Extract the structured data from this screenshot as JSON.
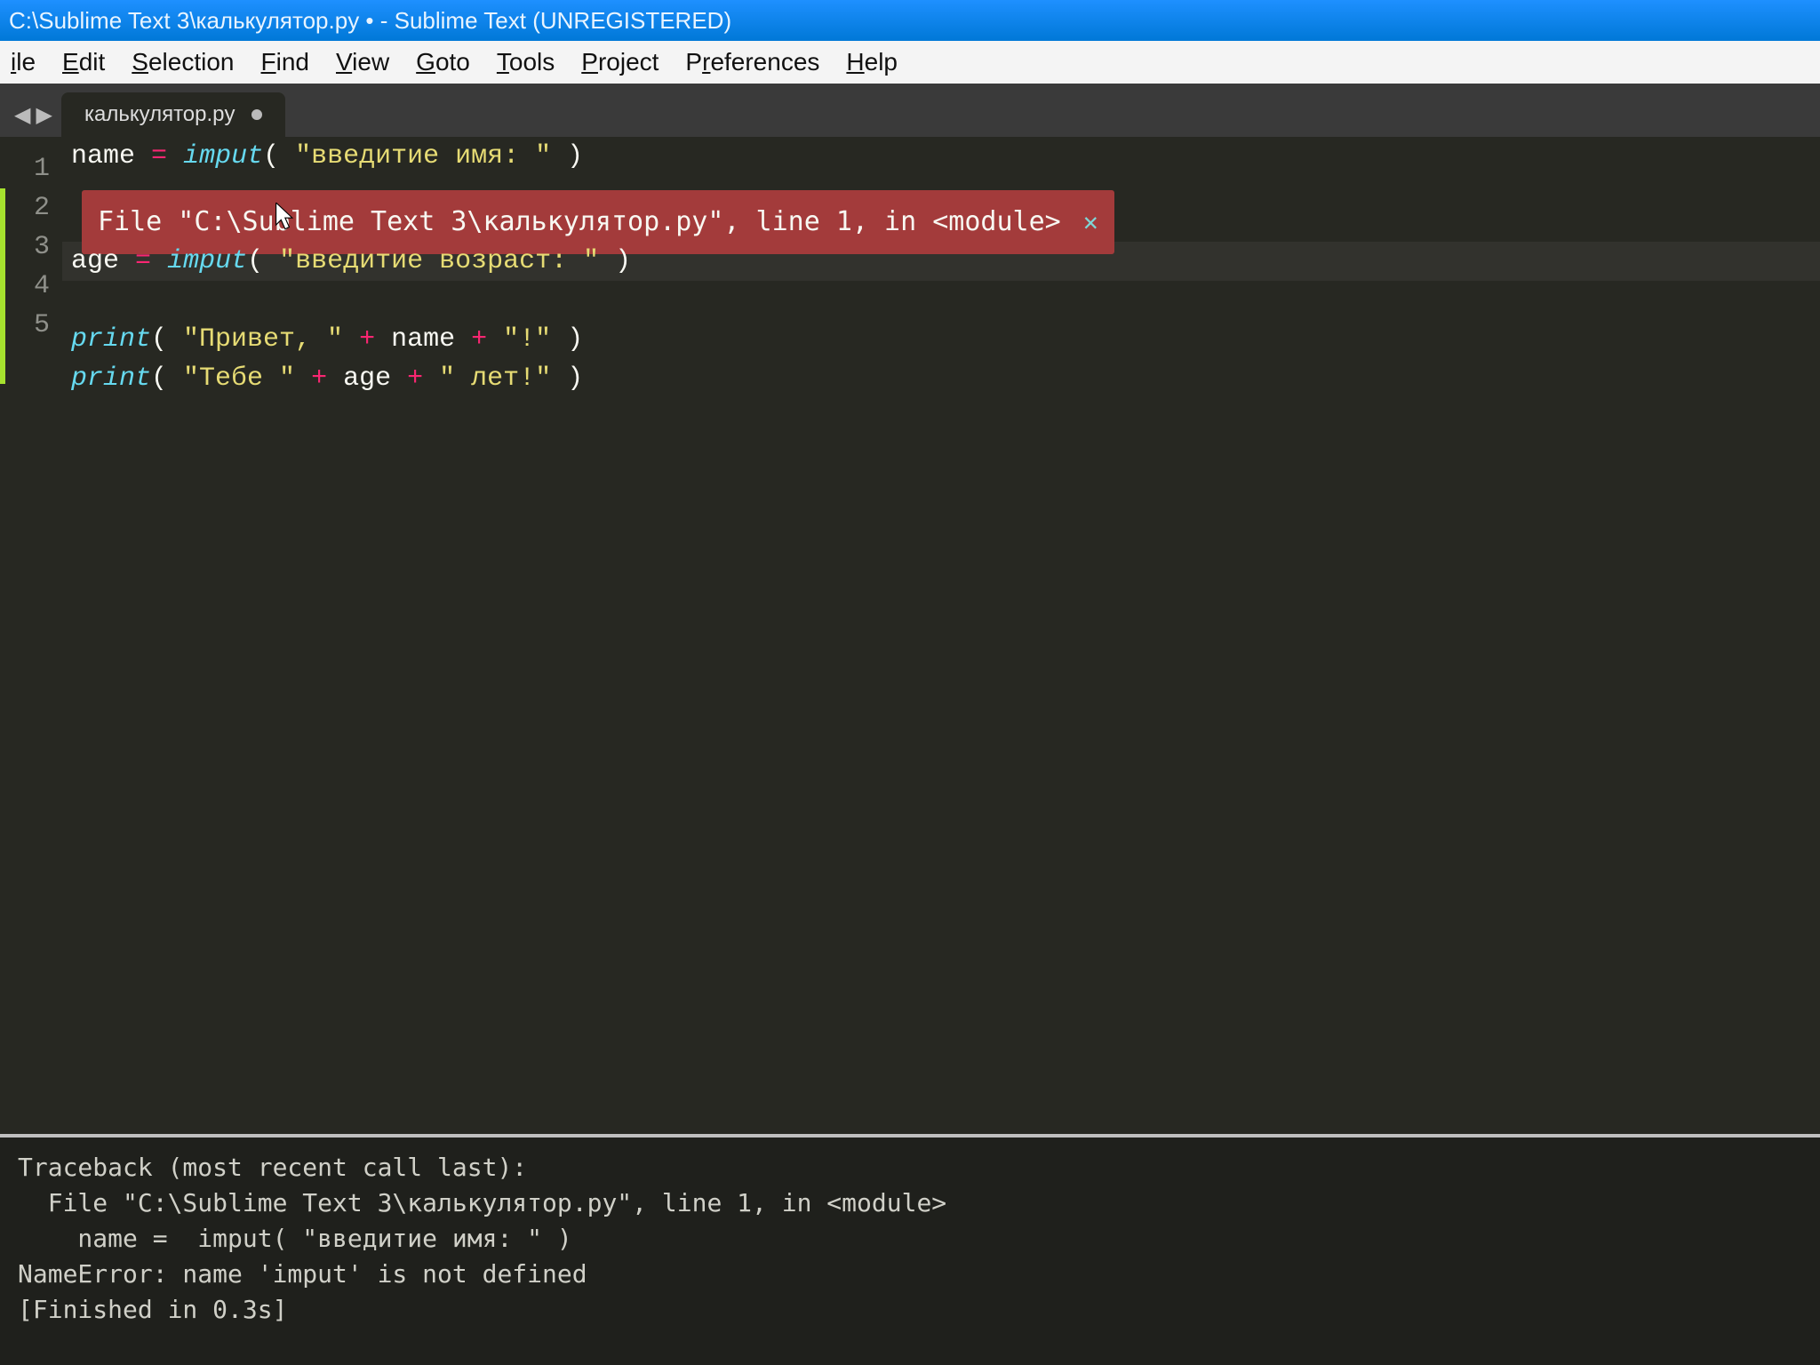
{
  "titleBar": {
    "text": "C:\\Sublime Text 3\\калькулятор.py • - Sublime Text (UNREGISTERED)"
  },
  "menu": {
    "items": [
      {
        "pre": "",
        "u": "i",
        "post": "le"
      },
      {
        "pre": "",
        "u": "E",
        "post": "dit"
      },
      {
        "pre": "",
        "u": "S",
        "post": "election"
      },
      {
        "pre": "",
        "u": "F",
        "post": "ind"
      },
      {
        "pre": "",
        "u": "V",
        "post": "iew"
      },
      {
        "pre": "",
        "u": "G",
        "post": "oto"
      },
      {
        "pre": "",
        "u": "T",
        "post": "ools"
      },
      {
        "pre": "",
        "u": "P",
        "post": "roject"
      },
      {
        "pre": "P",
        "u": "r",
        "post": "eferences"
      },
      {
        "pre": "",
        "u": "H",
        "post": "elp"
      }
    ]
  },
  "tabs": {
    "navBack": "◀",
    "navFwd": "▶",
    "items": [
      {
        "label": "калькулятор.py",
        "dirty": true
      }
    ]
  },
  "editor": {
    "lineNumbers": [
      "1",
      "2",
      "3",
      "4",
      "5"
    ],
    "activeLine": 2,
    "lines": [
      [
        {
          "cls": "tok-var",
          "t": "name"
        },
        {
          "cls": "tok-punc",
          "t": " "
        },
        {
          "cls": "tok-op",
          "t": "="
        },
        {
          "cls": "tok-punc",
          "t": " "
        },
        {
          "cls": "tok-func",
          "t": "imput"
        },
        {
          "cls": "tok-punc",
          "t": "( "
        },
        {
          "cls": "tok-str",
          "t": "\"введитие имя: \""
        },
        {
          "cls": "tok-punc",
          "t": " )"
        }
      ],
      [
        {
          "cls": "tok-var",
          "t": "age"
        },
        {
          "cls": "tok-punc",
          "t": " "
        },
        {
          "cls": "tok-op",
          "t": "="
        },
        {
          "cls": "tok-punc",
          "t": " "
        },
        {
          "cls": "tok-func",
          "t": "imput"
        },
        {
          "cls": "tok-punc",
          "t": "( "
        },
        {
          "cls": "tok-str",
          "t": "\"введитие возраст: \""
        },
        {
          "cls": "tok-punc",
          "t": " )"
        }
      ],
      [],
      [
        {
          "cls": "tok-func",
          "t": "print"
        },
        {
          "cls": "tok-punc",
          "t": "( "
        },
        {
          "cls": "tok-str",
          "t": "\"Привет, \""
        },
        {
          "cls": "tok-punc",
          "t": " "
        },
        {
          "cls": "tok-plus",
          "t": "+"
        },
        {
          "cls": "tok-punc",
          "t": " "
        },
        {
          "cls": "tok-var",
          "t": "name"
        },
        {
          "cls": "tok-punc",
          "t": " "
        },
        {
          "cls": "tok-plus",
          "t": "+"
        },
        {
          "cls": "tok-punc",
          "t": " "
        },
        {
          "cls": "tok-str",
          "t": "\"!\""
        },
        {
          "cls": "tok-punc",
          "t": " )"
        }
      ],
      [
        {
          "cls": "tok-func",
          "t": "print"
        },
        {
          "cls": "tok-punc",
          "t": "( "
        },
        {
          "cls": "tok-str",
          "t": "\"Тебе \""
        },
        {
          "cls": "tok-punc",
          "t": " "
        },
        {
          "cls": "tok-plus",
          "t": "+"
        },
        {
          "cls": "tok-punc",
          "t": " "
        },
        {
          "cls": "tok-var",
          "t": "age"
        },
        {
          "cls": "tok-punc",
          "t": " "
        },
        {
          "cls": "tok-plus",
          "t": "+"
        },
        {
          "cls": "tok-punc",
          "t": " "
        },
        {
          "cls": "tok-str",
          "t": "\" лет!\""
        },
        {
          "cls": "tok-punc",
          "t": " )"
        }
      ]
    ]
  },
  "errorPopup": {
    "text": "File \"C:\\Sublime Text 3\\калькулятор.py\", line 1, in <module>",
    "close": "✕"
  },
  "console": {
    "lines": [
      "Traceback (most recent call last):",
      "  File \"C:\\Sublime Text 3\\калькулятор.py\", line 1, in <module>",
      "    name =  imput( \"введитие имя: \" )",
      "NameError: name 'imput' is not defined",
      "[Finished in 0.3s]"
    ]
  }
}
